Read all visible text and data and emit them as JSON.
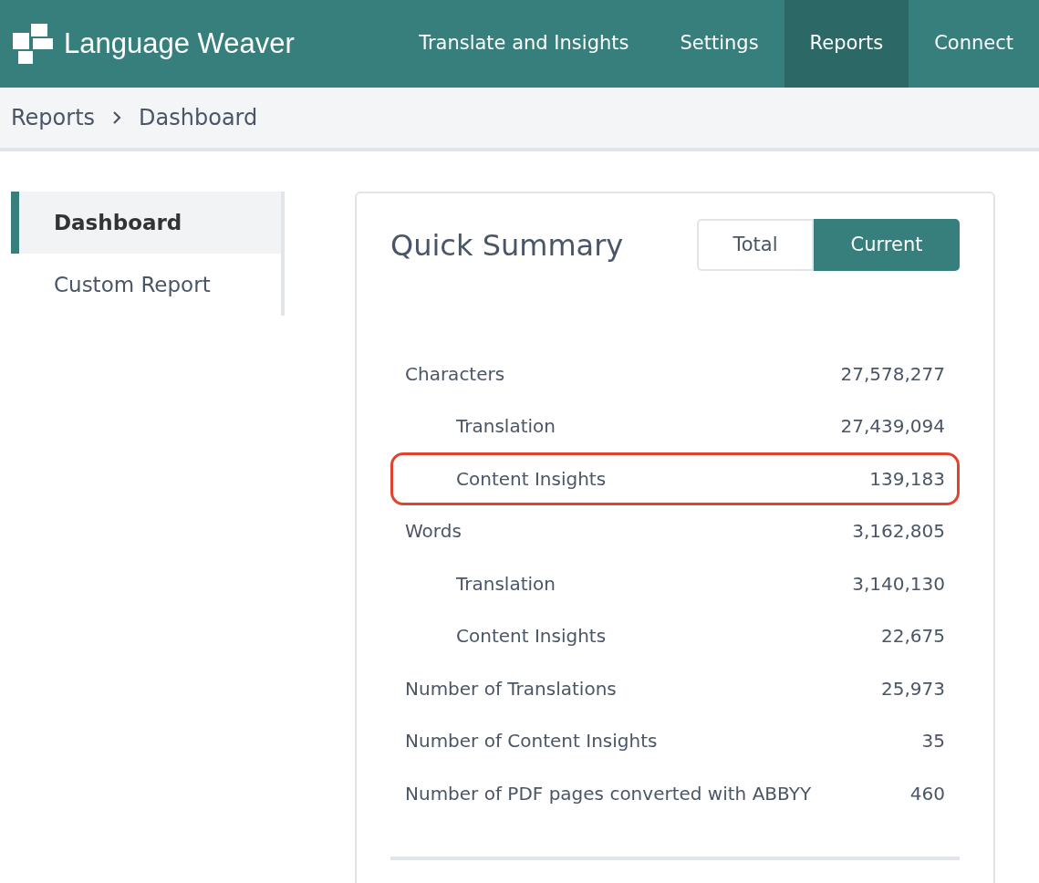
{
  "header": {
    "logo": "Language Weaver",
    "nav": [
      {
        "label": "Translate and Insights",
        "selected": false
      },
      {
        "label": "Settings",
        "selected": false
      },
      {
        "label": "Reports",
        "selected": true
      },
      {
        "label": "Connect",
        "selected": false
      }
    ]
  },
  "breadcrumb": [
    "Reports",
    "Dashboard"
  ],
  "sidebar": {
    "items": [
      {
        "label": "Dashboard",
        "selected": true
      },
      {
        "label": "Custom Report",
        "selected": false
      }
    ]
  },
  "summary": {
    "title": "Quick Summary",
    "toggle": [
      {
        "label": "Total",
        "selected": false
      },
      {
        "label": "Current",
        "selected": true
      }
    ],
    "rows": [
      {
        "label": "Characters",
        "value": "27,578,277",
        "highlighted": false,
        "children": [
          {
            "label": "Translation",
            "value": "27,439,094",
            "highlighted": false
          },
          {
            "label": "Content Insights",
            "value": "139,183",
            "highlighted": true
          }
        ]
      },
      {
        "label": "Words",
        "value": "3,162,805",
        "highlighted": false,
        "children": [
          {
            "label": "Translation",
            "value": "3,140,130",
            "highlighted": false
          },
          {
            "label": "Content Insights",
            "value": "22,675",
            "highlighted": false
          }
        ]
      },
      {
        "label": "Number of Translations",
        "value": "25,973",
        "highlighted": false
      },
      {
        "label": "Number of Content Insights",
        "value": "35",
        "highlighted": false
      },
      {
        "label": "Number of PDF pages converted with ABBYY",
        "value": "460",
        "highlighted": false
      }
    ]
  }
}
